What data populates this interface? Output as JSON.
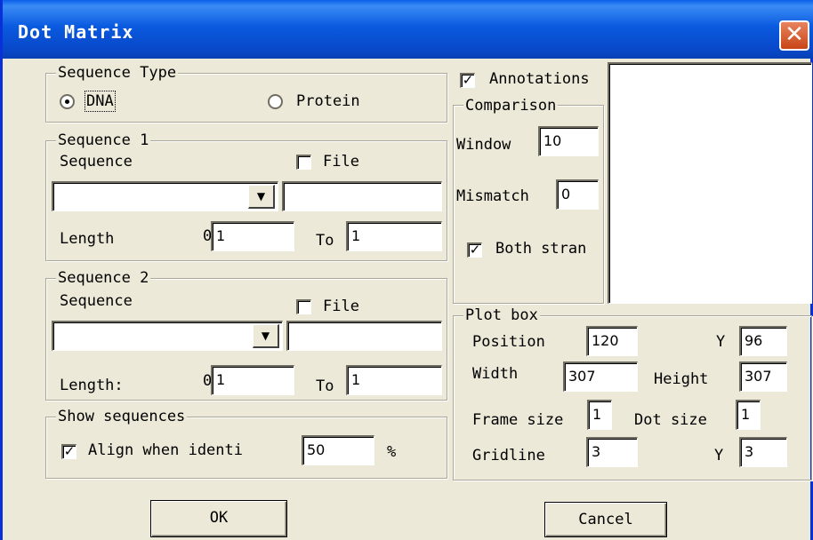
{
  "window": {
    "title": "Dot Matrix",
    "close_glyph": "✕"
  },
  "sequence_type": {
    "legend": "Sequence Type",
    "options": [
      {
        "label": "DNA",
        "selected": true
      },
      {
        "label": "Protein",
        "selected": false
      }
    ]
  },
  "sequence1": {
    "legend": "Sequence 1",
    "sequence_label": "Sequence",
    "file_label": "File",
    "file_checked": false,
    "combo_value": "",
    "file_value": "",
    "length_label": "Length",
    "from_value": "1",
    "to_label": "To",
    "to_value": "1"
  },
  "sequence2": {
    "legend": "Sequence 2",
    "sequence_label": "Sequence",
    "file_label": "File",
    "file_checked": false,
    "combo_value": "",
    "file_value": "",
    "length_label": "Length:",
    "from_value": "1",
    "to_label": "To",
    "to_value": "1"
  },
  "show_sequences": {
    "legend": "Show sequences",
    "align_label": "Align when identi",
    "align_checked": true,
    "percent_value": "50",
    "percent_label": "%"
  },
  "annotations": {
    "label": "Annotations",
    "checked": true
  },
  "comparison": {
    "legend": "Comparison",
    "window_label": "Window",
    "window_value": "10",
    "mismatch_label": "Mismatch",
    "mismatch_value": "0",
    "both_strands_label": "Both stran",
    "both_strands_checked": true
  },
  "plot_box": {
    "legend": "Plot box",
    "position_label": "Position",
    "position_value": "120",
    "y_label": "Y",
    "y_value": "96",
    "width_label": "Width",
    "width_value": "307",
    "height_label": "Height",
    "height_value": "307",
    "frame_size_label": "Frame size",
    "frame_size_value": "1",
    "dot_size_label": "Dot size",
    "dot_size_value": "1",
    "gridline_label": "Gridline",
    "gridline_value": "3",
    "gridline_y_label": "Y",
    "gridline_y_value": "3"
  },
  "buttons": {
    "ok": "OK",
    "cancel": "Cancel"
  },
  "glyphs": {
    "check": "✓",
    "zero": "0",
    "dropdown": "▼"
  },
  "colors": {
    "titlebar": "#0a5ae0",
    "dialog": "#ece9d8",
    "close": "#c84518"
  }
}
